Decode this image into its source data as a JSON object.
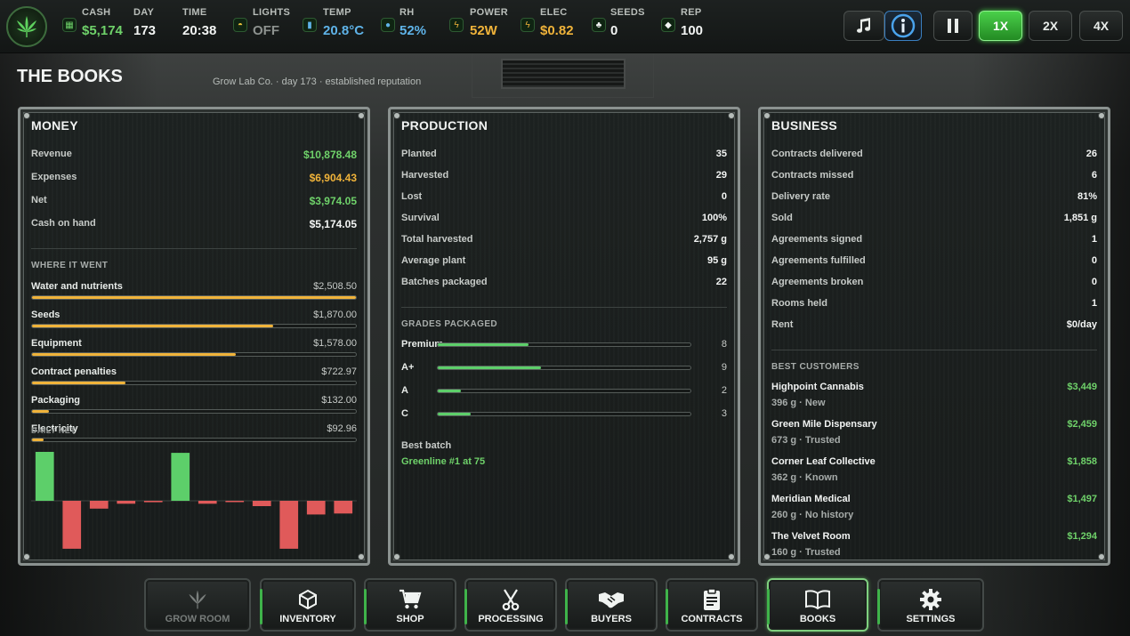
{
  "stats": [
    {
      "label": "CASH",
      "value": "$5,174",
      "color": "#6fd26a",
      "icon": "cash-icon",
      "glyph": "▦"
    },
    {
      "label": "DAY",
      "value": "173",
      "color": "#f2f4f3",
      "icon": "",
      "glyph": ""
    },
    {
      "label": "TIME",
      "value": "20:38",
      "color": "#f2f4f3",
      "icon": "",
      "glyph": ""
    },
    {
      "label": "LIGHTS",
      "value": "OFF",
      "color": "#8d928f",
      "icon": "bulb-icon",
      "glyph": "◓"
    },
    {
      "label": "TEMP",
      "value": "20.8°C",
      "color": "#5fb3e8",
      "icon": "thermometer-icon",
      "glyph": "▮"
    },
    {
      "label": "RH",
      "value": "52%",
      "color": "#5fb3e8",
      "icon": "droplet-icon",
      "glyph": "●"
    },
    {
      "label": "POWER",
      "value": "52W",
      "color": "#f0b33a",
      "icon": "bolt-icon",
      "glyph": "ϟ"
    },
    {
      "label": "ELEC",
      "value": "$0.82",
      "color": "#f0b33a",
      "icon": "bolt-icon",
      "glyph": "ϟ"
    },
    {
      "label": "SEEDS",
      "value": "0",
      "color": "#f2f4f3",
      "icon": "leaf-icon",
      "glyph": "♣"
    },
    {
      "label": "REP",
      "value": "100",
      "color": "#f2f4f3",
      "icon": "shield-icon",
      "glyph": "◆"
    }
  ],
  "speed": {
    "x1": "1X",
    "x2": "2X",
    "x4": "4X"
  },
  "page": {
    "title": "THE BOOKS",
    "subtitle": "Grow Lab Co.  ·  day 173  ·  established reputation"
  },
  "money": {
    "title": "MONEY",
    "rows": [
      {
        "k": "Revenue",
        "v": "$10,878.48",
        "color": "#6fd26a"
      },
      {
        "k": "Expenses",
        "v": "$6,904.43",
        "color": "#f0b33a"
      },
      {
        "k": "Net",
        "v": "$3,974.05",
        "color": "#6fd26a"
      },
      {
        "k": "Cash on hand",
        "v": "$5,174.05",
        "color": "#f4f6f5"
      }
    ],
    "where_title": "WHERE IT WENT",
    "where": [
      {
        "k": "Water and nutrients",
        "v": "$2,508.50",
        "frac": 1.0
      },
      {
        "k": "Seeds",
        "v": "$1,870.00",
        "frac": 0.745
      },
      {
        "k": "Equipment",
        "v": "$1,578.00",
        "frac": 0.629
      },
      {
        "k": "Contract penalties",
        "v": "$722.97",
        "frac": 0.288
      },
      {
        "k": "Packaging",
        "v": "$132.00",
        "frac": 0.053
      },
      {
        "k": "Electricity",
        "v": "$92.96",
        "frac": 0.037
      }
    ],
    "daily_title": "DAILY NET"
  },
  "chart_data": {
    "type": "bar",
    "title": "DAILY NET",
    "values": [
      1,
      -0.98,
      -0.16,
      -0.06,
      -0.03,
      0.98,
      -0.06,
      -0.01,
      -0.11,
      -0.98,
      -0.28,
      -0.26
    ],
    "ylim": [
      -1,
      1
    ],
    "colors": {
      "positive": "#5dcf6a",
      "negative": "#e05a5a"
    }
  },
  "production": {
    "title": "PRODUCTION",
    "rows": [
      {
        "k": "Planted",
        "v": "35"
      },
      {
        "k": "Harvested",
        "v": "29"
      },
      {
        "k": "Lost",
        "v": "0"
      },
      {
        "k": "Survival",
        "v": "100%"
      },
      {
        "k": "Total harvested",
        "v": "2,757 g"
      },
      {
        "k": "Average plant",
        "v": "95 g"
      },
      {
        "k": "Batches packaged",
        "v": "22"
      }
    ],
    "grades_title": "GRADES PACKAGED",
    "grades": [
      {
        "k": "Premium",
        "v": "8",
        "frac": 0.36
      },
      {
        "k": "A+",
        "v": "9",
        "frac": 0.41
      },
      {
        "k": "A",
        "v": "2",
        "frac": 0.09
      },
      {
        "k": "C",
        "v": "3",
        "frac": 0.13
      }
    ],
    "best_title": "Best batch",
    "best_value": "Greenline #1 at 75"
  },
  "business": {
    "title": "BUSINESS",
    "rows": [
      {
        "k": "Contracts delivered",
        "v": "26"
      },
      {
        "k": "Contracts missed",
        "v": "6"
      },
      {
        "k": "Delivery rate",
        "v": "81%"
      },
      {
        "k": "Sold",
        "v": "1,851 g"
      },
      {
        "k": "Agreements signed",
        "v": "1"
      },
      {
        "k": "Agreements fulfilled",
        "v": "0"
      },
      {
        "k": "Agreements broken",
        "v": "0"
      },
      {
        "k": "Rooms held",
        "v": "1"
      },
      {
        "k": "Rent",
        "v": "$0/day"
      }
    ],
    "customers_title": "BEST CUSTOMERS",
    "customers": [
      {
        "name": "Highpoint Cannabis",
        "amount": "$3,449",
        "detail": "396 g  ·  New"
      },
      {
        "name": "Green Mile Dispensary",
        "amount": "$2,459",
        "detail": "673 g  ·  Trusted"
      },
      {
        "name": "Corner Leaf Collective",
        "amount": "$1,858",
        "detail": "362 g  ·  Known"
      },
      {
        "name": "Meridian Medical",
        "amount": "$1,497",
        "detail": "260 g  ·  No history"
      },
      {
        "name": "The Velvet Room",
        "amount": "$1,294",
        "detail": "160 g  ·  Trusted"
      }
    ]
  },
  "nav": [
    {
      "label": "GROW ROOM",
      "icon": "cannabis-leaf-icon",
      "state": "dim"
    },
    {
      "label": "INVENTORY",
      "icon": "box-icon",
      "state": ""
    },
    {
      "label": "SHOP",
      "icon": "cart-icon",
      "state": ""
    },
    {
      "label": "PROCESSING",
      "icon": "scissors-icon",
      "state": ""
    },
    {
      "label": "BUYERS",
      "icon": "handshake-icon",
      "state": ""
    },
    {
      "label": "CONTRACTS",
      "icon": "clipboard-icon",
      "state": ""
    },
    {
      "label": "BOOKS",
      "icon": "book-icon",
      "state": "active"
    },
    {
      "label": "SETTINGS",
      "icon": "gear-icon",
      "state": ""
    }
  ]
}
